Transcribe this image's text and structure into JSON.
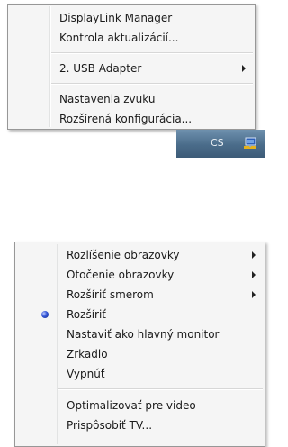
{
  "top_menu": {
    "items": [
      {
        "label": "DisplayLink Manager"
      },
      {
        "label": "Kontrola aktualizácií..."
      },
      {
        "label": "2. USB Adapter",
        "submenu": true
      },
      {
        "label": "Nastavenia zvuku"
      },
      {
        "label": "Rozšírená konfigurácia..."
      }
    ]
  },
  "taskbar": {
    "language": "CS",
    "tray_icon": "displaylink-monitor-icon"
  },
  "bottom_menu": {
    "items": [
      {
        "label": "Rozlíšenie obrazovky",
        "submenu": true
      },
      {
        "label": "Otočenie obrazovky",
        "submenu": true
      },
      {
        "label": "Rozšíriť smerom",
        "submenu": true
      },
      {
        "label": "Rozšíriť",
        "selected": true
      },
      {
        "label": "Nastaviť ako hlavný monitor"
      },
      {
        "label": "Zrkadlo"
      },
      {
        "label": "Vypnúť"
      },
      {
        "label": "Optimalizovať pre video"
      },
      {
        "label": "Prispôsobiť TV..."
      }
    ]
  },
  "colors": {
    "menu_bg": "#f5f5f5",
    "menu_border": "#979797",
    "taskbar": "#4a6c8a",
    "radio_selected": "#3355d6"
  }
}
